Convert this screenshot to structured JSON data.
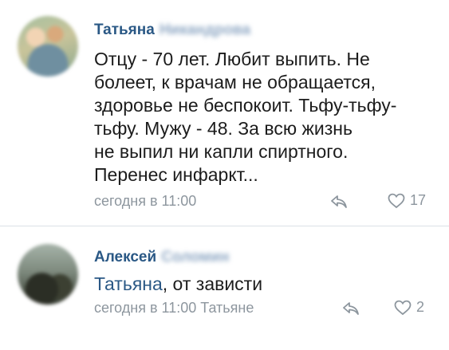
{
  "comments": [
    {
      "author_first": "Татьяна",
      "author_last": "Никандрова",
      "lines": [
        "Отцу - 70 лет. Любит выпить. Не",
        "болеет, к врачам не обращается,",
        "здоровье не беспокоит. Тьфу-тьфу-",
        "тьфу. Мужу - 48. За всю жизнь",
        "не выпил ни капли спиртного.",
        "Перенес инфаркт..."
      ],
      "time": "сегодня в 11:00",
      "likes": "17",
      "icons": {
        "reply": "reply-icon",
        "like": "heart-icon"
      }
    },
    {
      "author_first": "Алексей",
      "author_last": "Соломин",
      "reply_to": "Татьяна",
      "text_rest": ", от зависти",
      "time": "сегодня в 11:00 Татьяне",
      "likes": "2",
      "icons": {
        "reply": "reply-icon",
        "like": "heart-icon"
      }
    }
  ],
  "colors": {
    "author": "#2a5885",
    "text": "#1c1c1c",
    "meta": "#8d969e",
    "divider": "#dce1e6"
  }
}
